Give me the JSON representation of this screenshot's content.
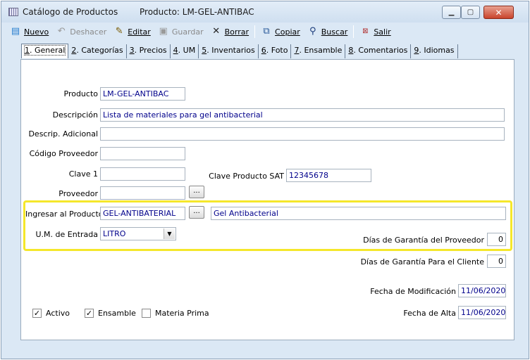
{
  "window": {
    "title": "Catálogo de Productos",
    "subtitle": "Producto: LM-GEL-ANTIBAC"
  },
  "toolbar": {
    "nuevo": "Nuevo",
    "deshacer": "Deshacer",
    "editar": "Editar",
    "guardar": "Guardar",
    "borrar": "Borrar",
    "copiar": "Copiar",
    "buscar": "Buscar",
    "salir": "Salir"
  },
  "tabs": [
    {
      "num": "1",
      "label": ". General"
    },
    {
      "num": "2",
      "label": ". Categorías"
    },
    {
      "num": "3",
      "label": ". Precios"
    },
    {
      "num": "4",
      "label": ". UM"
    },
    {
      "num": "5",
      "label": ". Inventarios"
    },
    {
      "num": "6",
      "label": ". Foto"
    },
    {
      "num": "7",
      "label": ". Ensamble"
    },
    {
      "num": "8",
      "label": ". Comentarios"
    },
    {
      "num": "9",
      "label": ". Idiomas"
    }
  ],
  "form": {
    "producto_label": "Producto",
    "producto_value": "LM-GEL-ANTIBAC",
    "descripcion_label": "Descripción",
    "descripcion_value": "Lista de materiales para gel antibacterial",
    "descrip_adicional_label": "Descrip. Adicional",
    "descrip_adicional_value": "",
    "codigo_proveedor_label": "Código Proveedor",
    "codigo_proveedor_value": "",
    "clave1_label": "Clave 1",
    "clave1_value": "",
    "clave_sat_label": "Clave Producto SAT",
    "clave_sat_value": "12345678",
    "proveedor_label": "Proveedor",
    "proveedor_value": "",
    "ingresar_label": "Ingresar al Producto",
    "ingresar_value": "GEL-ANTIBATERIAL",
    "ingresar_desc": "Gel Antibacterial",
    "um_entrada_label": "U.M. de Entrada",
    "um_entrada_value": "LITRO",
    "garantia_proveedor_label": "Días de Garantía del Proveedor",
    "garantia_proveedor_value": "0",
    "garantia_cliente_label": "Días de Garantía Para el Cliente",
    "garantia_cliente_value": "0",
    "fecha_mod_label": "Fecha de Modificación",
    "fecha_mod_value": "11/06/2020",
    "fecha_alta_label": "Fecha de Alta",
    "fecha_alta_value": "11/06/2020",
    "activo_label": "Activo",
    "activo_checked": true,
    "ensamble_label": "Ensamble",
    "ensamble_checked": true,
    "materia_prima_label": "Materia Prima",
    "materia_prima_checked": false,
    "dots_label": "..."
  },
  "colors": {
    "highlight": "#f5e72b",
    "field_text": "#00008b",
    "chrome": "#dbe8f5"
  }
}
